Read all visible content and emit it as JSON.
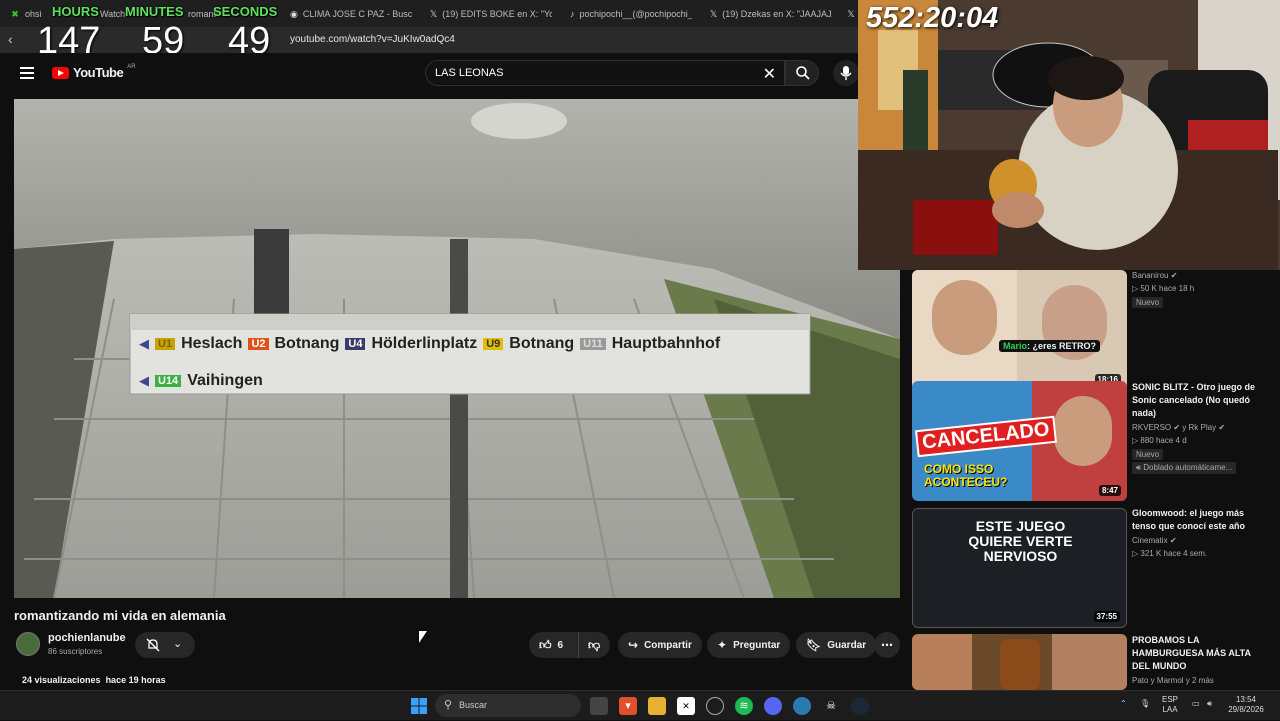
{
  "browser": {
    "tabs": [
      {
        "label": "ohsi",
        "icon": "app-icon"
      },
      {
        "label": "Watch",
        "icon": "app-icon"
      },
      {
        "label": "romanti",
        "icon": "app-icon"
      },
      {
        "label": "CLIMA JOSE C PAZ - Buscar co",
        "icon": "google-icon"
      },
      {
        "label": "(19) EDITS BOKE en X: \"Yo fest",
        "icon": "x-icon"
      },
      {
        "label": "pochipochi__(@pochipochi__",
        "icon": "tiktok-icon"
      },
      {
        "label": "(19) Dzekas en X: \"JAAJAJAJA",
        "icon": "x-icon"
      }
    ],
    "url": "youtube.com/watch?v=JuKIw0adQc4"
  },
  "overlay_timer": {
    "labels": {
      "hours": "HOURS",
      "minutes": "MINUTES",
      "seconds": "SECONDS"
    },
    "values": {
      "hours": "147",
      "minutes": "59",
      "seconds": "49"
    },
    "total": "552:20:04"
  },
  "youtube": {
    "logo": "YouTube",
    "region": "AR",
    "search_value": "LAS LEONAS"
  },
  "video": {
    "sign_row1": [
      {
        "line": "U1",
        "dest": "Heslach",
        "color": "#c9a400"
      },
      {
        "line": "U2",
        "dest": "Botnang",
        "color": "#e0501a"
      },
      {
        "line": "U4",
        "dest": "Hölderlinplatz",
        "color": "#3b3b6e"
      },
      {
        "line": "U9",
        "dest": "Botnang",
        "color": "#e0c000"
      },
      {
        "line": "U11",
        "dest": "Hauptbahnhof",
        "color": "#9a9a9a"
      }
    ],
    "sign_row2": [
      {
        "line": "U14",
        "dest": "Vaihingen",
        "color": "#3cb043"
      }
    ],
    "title": "romantizando mi vida en alemania",
    "channel": "pochienlanube",
    "subscribers": "86 suscriptores",
    "likes": "6",
    "share": "Compartir",
    "ask": "Preguntar",
    "save": "Guardar",
    "views": "24 visualizaciones",
    "age": "hace 19 horas"
  },
  "recommendations": [
    {
      "title": "",
      "channel": "Bananirou",
      "meta": "50 K  hace 18 h",
      "badge": "Nuevo",
      "duration": "18:16",
      "caption": "¿eres RETRO?",
      "caption_prefix": "Mario"
    },
    {
      "title": "SONIC BLITZ - Otro juego de Sonic cancelado (No quedó nada)",
      "channel": "RKVERSO",
      "channel2": "y Rk Play",
      "meta": "880  hace 4 d",
      "badge": "Nuevo",
      "badge2": "Doblado automáticame...",
      "duration": "8:47",
      "thumb_text1": "CANCELADO",
      "thumb_text2": "COMO ISSO ACONTECEU?"
    },
    {
      "title": "Gloomwood: el juego más tenso que conocí este año",
      "channel": "Cinematix",
      "meta": "321 K  hace 4 sem.",
      "duration": "37:55",
      "thumb_text": "ESTE JUEGO QUIERE VERTE NERVIOSO"
    },
    {
      "title": "PROBAMOS LA HAMBURGUESA MÁS ALTA DEL MUNDO",
      "channel": "Pato y Marmol y 2 más"
    }
  ],
  "taskbar": {
    "search": "Buscar",
    "lang1": "ESP",
    "lang2": "LAA",
    "time": "13:54",
    "date": "29/8/2026"
  }
}
